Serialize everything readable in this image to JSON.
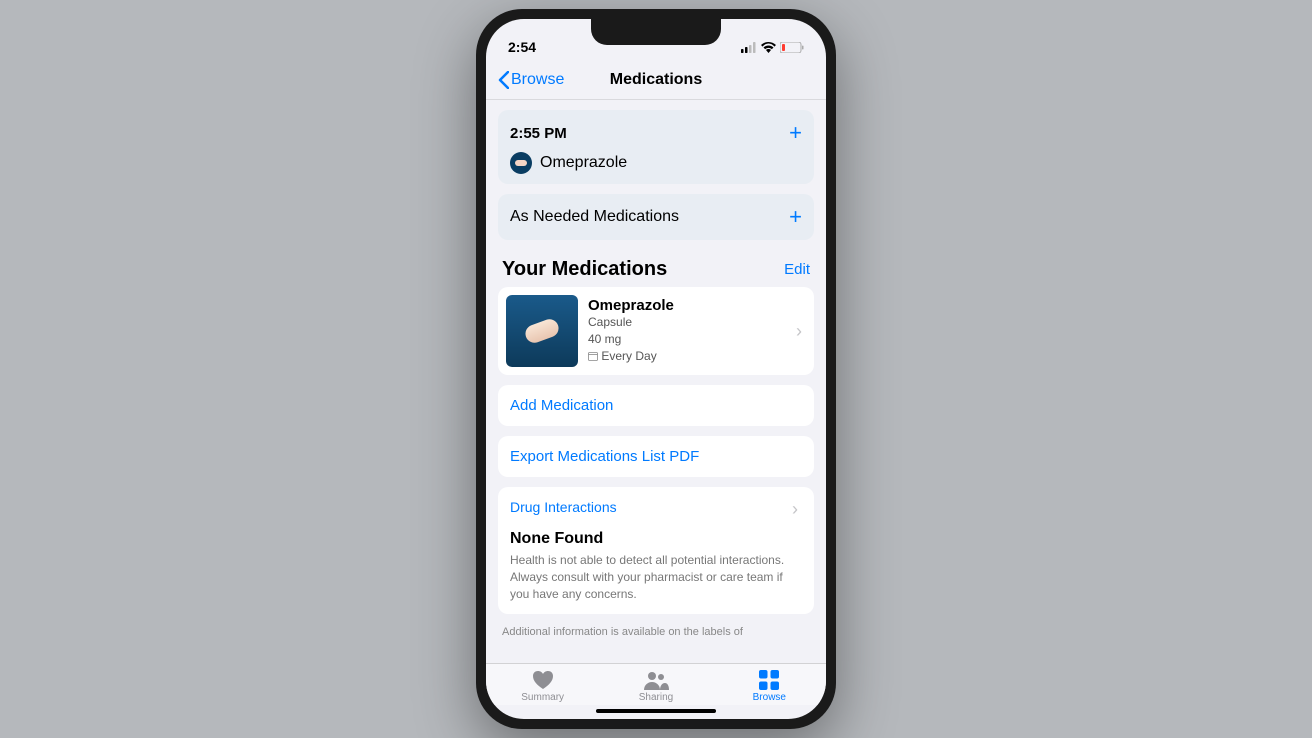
{
  "statusbar": {
    "time": "2:54"
  },
  "nav": {
    "back": "Browse",
    "title": "Medications"
  },
  "schedule": {
    "time": "2:55 PM",
    "med": "Omeprazole"
  },
  "asneeded": {
    "label": "As Needed Medications"
  },
  "yourmeds": {
    "title": "Your Medications",
    "edit": "Edit"
  },
  "med": {
    "name": "Omeprazole",
    "form": "Capsule",
    "dose": "40 mg",
    "freq": "Every Day"
  },
  "actions": {
    "add": "Add Medication",
    "export": "Export Medications List PDF"
  },
  "di": {
    "title": "Drug Interactions",
    "status": "None Found",
    "desc": "Health is not able to detect all potential interactions. Always consult with your pharmacist or care team if you have any concerns."
  },
  "footer": "Additional information is available on the labels of",
  "tabs": {
    "summary": "Summary",
    "sharing": "Sharing",
    "browse": "Browse"
  }
}
